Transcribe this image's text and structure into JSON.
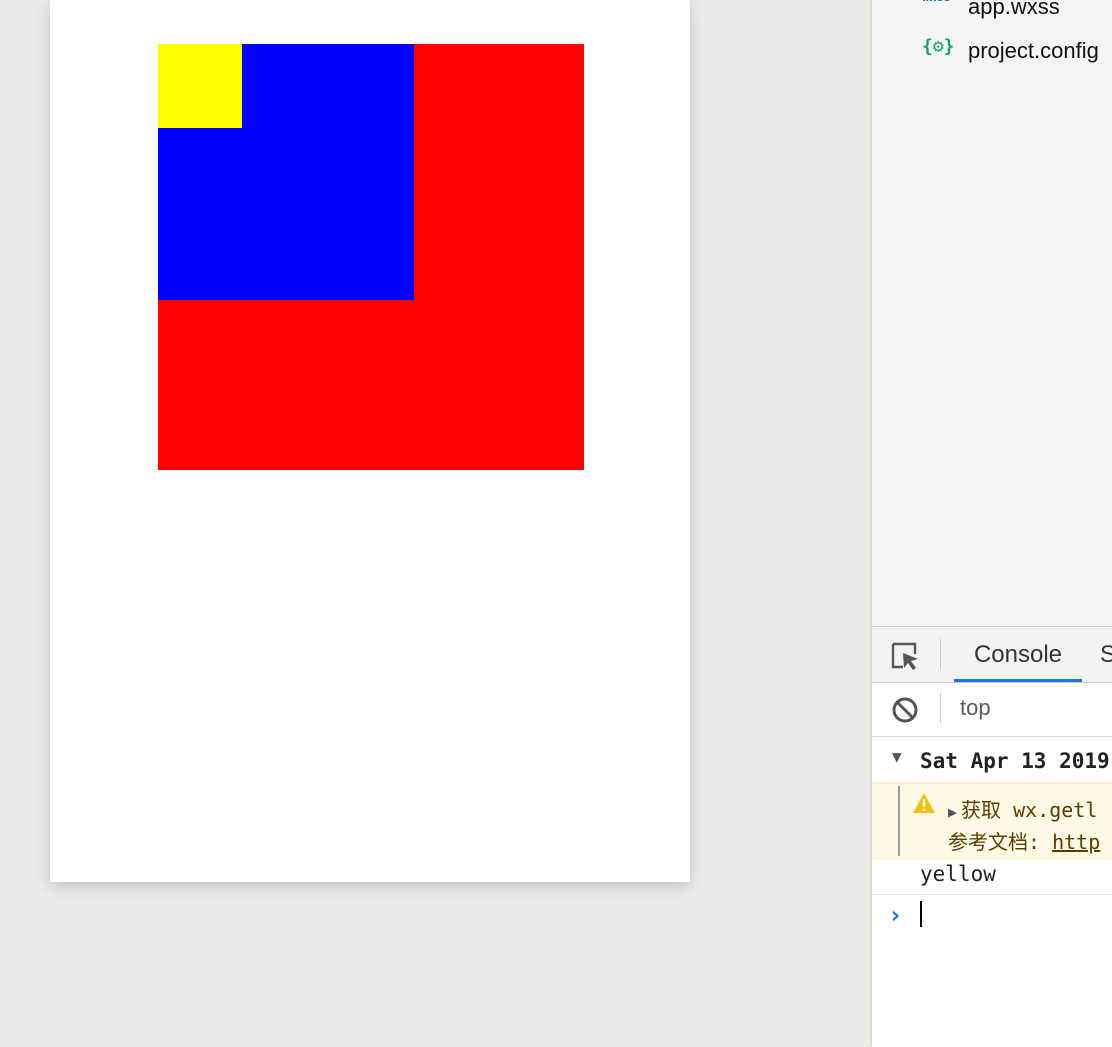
{
  "colors": {
    "outer_box": "#ff0000",
    "middle_box": "#0000ff",
    "inner_box": "#ffff00"
  },
  "file_tree": {
    "items": [
      {
        "icon_text": "wxss",
        "name": "app.wxss",
        "icon": "wxss-file-icon"
      },
      {
        "icon_text": "{⚙}",
        "name": "project.config",
        "icon": "json-config-icon"
      }
    ]
  },
  "devtools": {
    "tabs": {
      "console": "Console",
      "next_partial": "S"
    },
    "context": "top",
    "group_header": "Sat Apr 13 2019",
    "warning": {
      "line1": "获取 wx.getl",
      "line2_label": "参考文档:",
      "line2_link": "http"
    },
    "log": "yellow",
    "prompt": "›"
  }
}
